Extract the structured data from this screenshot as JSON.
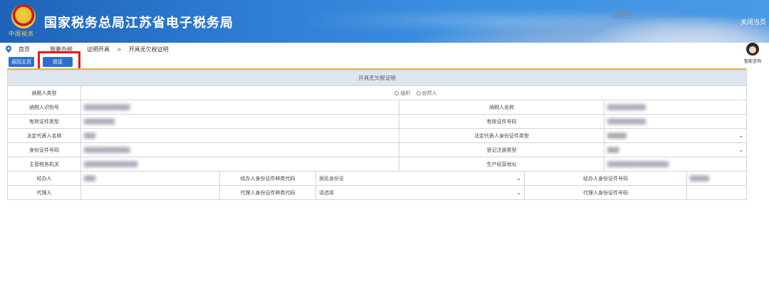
{
  "header": {
    "title": "国家税务总局江苏省电子税务局",
    "emblem_text": "中国税务",
    "close_label": "关闭当页"
  },
  "breadcrumb": {
    "items": [
      "首页",
      "我要办税",
      "证明开具",
      "开具无欠税证明"
    ],
    "separator": ">"
  },
  "buttons": {
    "home_label": "返回主页",
    "verify_label": "验证"
  },
  "assistant": {
    "label": "智能咨询"
  },
  "form": {
    "title": "开具无欠税证明",
    "labels": {
      "taxpayer_type": "纳税人类型",
      "taxpayer_id": "纳税人识别号",
      "taxpayer_name": "纳税人名称",
      "id_doc_type": "有效证件类型",
      "id_doc_number": "有效证件号码",
      "legal_rep_name": "法定代表人名称",
      "legal_rep_id_type": "法定代表人身份证件类型",
      "id_number": "身份证件号码",
      "reg_type": "登记注册类型",
      "tax_authority": "主管税务机关",
      "business_address": "生产经营地址",
      "agent": "经办人",
      "agent_id_type": "经办人身份证件种类代码",
      "agent_id_number": "经办人身份证件号码",
      "proxy": "代理人",
      "proxy_id_type": "代理人身份证件种类代码",
      "proxy_id_number": "代理人身份证件号码"
    },
    "radio": {
      "org": "组织",
      "person": "自然人"
    },
    "selects": {
      "agent_id_type_value": "居民身份证",
      "proxy_id_type_value": "请选择"
    }
  }
}
